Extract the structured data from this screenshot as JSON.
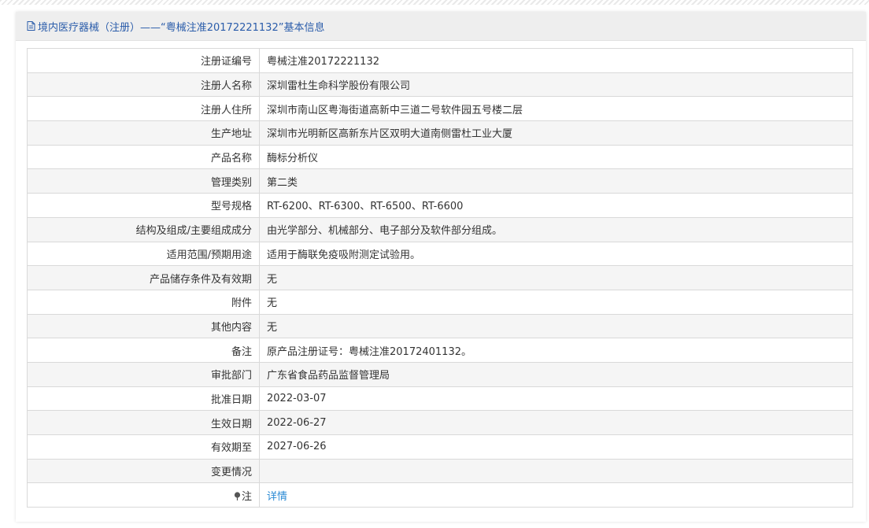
{
  "panel": {
    "title": "境内医疗器械（注册）——“粤械注准20172221132”基本信息"
  },
  "rows": [
    {
      "label": "注册证编号",
      "value": "粤械注准20172221132"
    },
    {
      "label": "注册人名称",
      "value": "深圳雷杜生命科学股份有限公司"
    },
    {
      "label": "注册人住所",
      "value": "深圳市南山区粤海街道高新中三道二号软件园五号楼二层"
    },
    {
      "label": "生产地址",
      "value": "深圳市光明新区高新东片区双明大道南侧雷杜工业大厦"
    },
    {
      "label": "产品名称",
      "value": "酶标分析仪"
    },
    {
      "label": "管理类别",
      "value": "第二类"
    },
    {
      "label": "型号规格",
      "value": "RT-6200、RT-6300、RT-6500、RT-6600"
    },
    {
      "label": "结构及组成/主要组成成分",
      "value": "由光学部分、机械部分、电子部分及软件部分组成。"
    },
    {
      "label": "适用范围/预期用途",
      "value": "适用于酶联免疫吸附测定试验用。"
    },
    {
      "label": "产品储存条件及有效期",
      "value": "无"
    },
    {
      "label": "附件",
      "value": "无"
    },
    {
      "label": "其他内容",
      "value": "无"
    },
    {
      "label": "备注",
      "value": "原产品注册证号：粤械注准20172401132。"
    },
    {
      "label": "审批部门",
      "value": "广东省食品药品监督管理局"
    },
    {
      "label": "批准日期",
      "value": "2022-03-07"
    },
    {
      "label": "生效日期",
      "value": "2022-06-27"
    },
    {
      "label": "有效期至",
      "value": "2027-06-26"
    },
    {
      "label": "变更情况",
      "value": ""
    }
  ],
  "note": {
    "label": "注",
    "link_text": "详情",
    "icon": "pin-icon"
  },
  "colors": {
    "header_text": "#2a5caa",
    "link": "#2a8ad4",
    "border": "#d9d9d9",
    "row_alt": "#f5f5f5",
    "header_bg": "#eeeeee"
  }
}
